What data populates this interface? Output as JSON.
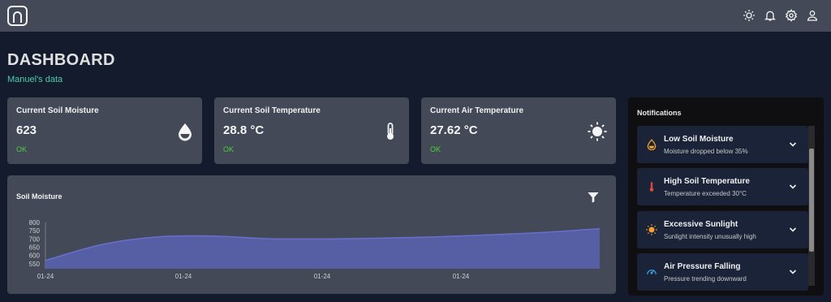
{
  "topbar": {
    "icons": [
      "light-mode-icon",
      "notifications-icon",
      "settings-icon",
      "user-icon"
    ]
  },
  "header": {
    "title": "DASHBOARD",
    "subtitle": "Manuel's data"
  },
  "stats": [
    {
      "title": "Current Soil Moisture",
      "value": "623",
      "status": "OK",
      "icon": "water-drop-icon"
    },
    {
      "title": "Current Soil Temperature",
      "value": "28.8 °C",
      "status": "OK",
      "icon": "thermometer-icon"
    },
    {
      "title": "Current Air Temperature",
      "value": "27.62 °C",
      "status": "OK",
      "icon": "sun-icon"
    }
  ],
  "chart_panel": {
    "title": "Soil Moisture",
    "filter_icon": "filter-icon"
  },
  "chart_data": {
    "type": "area",
    "title": "Soil Moisture",
    "xlabel": "",
    "ylabel": "",
    "x_tick_labels": [
      "01-24",
      "01-24",
      "01-24",
      "01-24"
    ],
    "y_ticks": [
      550,
      600,
      650,
      700,
      750,
      800
    ],
    "ylim": [
      520,
      800
    ],
    "xlim": [
      0,
      1
    ],
    "grid": false,
    "series": [
      {
        "x": [
          0.0,
          0.1,
          0.2,
          0.3,
          0.4,
          0.5,
          0.6,
          0.7,
          0.8,
          0.9,
          1.0
        ],
        "values": [
          570,
          665,
          712,
          718,
          702,
          700,
          705,
          712,
          725,
          740,
          762
        ]
      }
    ],
    "colors": {
      "fill": "#5b64b8",
      "line": "#6870cf"
    }
  },
  "notifications": {
    "header": "Notifications",
    "items": [
      {
        "title": "Low Soil Moisture",
        "description": "Moisture dropped below 35%",
        "icon": "water-drop-icon",
        "color": "#f0a030"
      },
      {
        "title": "High Soil Temperature",
        "description": "Temperature exceeded 30°C",
        "icon": "thermometer-icon",
        "color": "#e04848"
      },
      {
        "title": "Excessive Sunlight",
        "description": "Sunlight intensity unusually high",
        "icon": "sun-icon",
        "color": "#f0a030"
      },
      {
        "title": "Air Pressure Falling",
        "description": "Pressure trending downward",
        "icon": "gauge-icon",
        "color": "#3aa8e0"
      }
    ]
  },
  "colors": {
    "background": "#141b2d",
    "card": "#434957",
    "accent_green": "#4cceac",
    "ok_green": "#4cd137"
  }
}
